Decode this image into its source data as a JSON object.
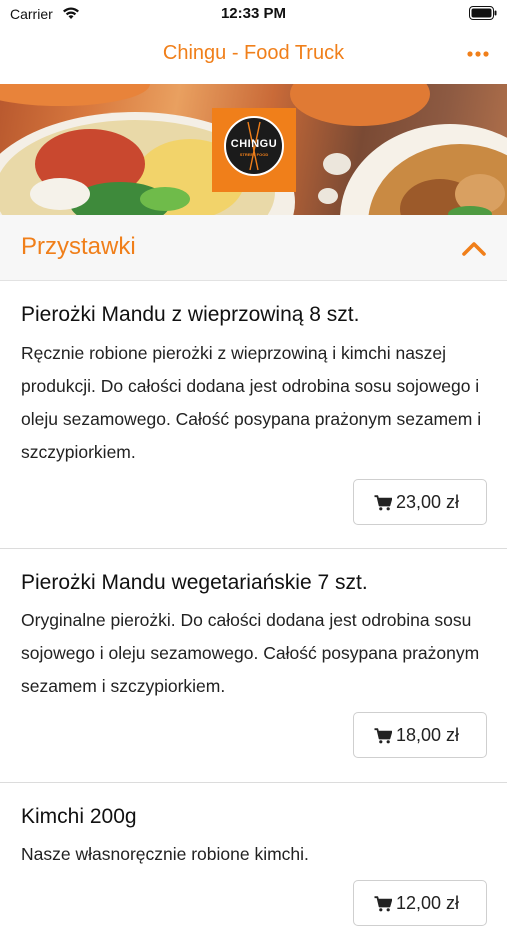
{
  "status_bar": {
    "carrier": "Carrier",
    "time": "12:33 PM"
  },
  "nav": {
    "title": "Chingu - Food Truck",
    "more_icon": "more-horizontal-icon"
  },
  "banner": {
    "logo_text": "CHINGU",
    "logo_subtext": "STREET FOOD"
  },
  "section": {
    "title": "Przystawki",
    "toggle_icon": "chevron-up-icon"
  },
  "items": [
    {
      "name": "Pierożki Mandu z wieprzowiną 8 szt.",
      "description": "Ręcznie robione pierożki z wieprzowiną i kimchi naszej produkcji. Do całości dodana jest odrobina sosu sojowego i oleju sezamowego. Całość posypana prażonym sezamem i szczypiorkiem.",
      "price": "23,00 zł"
    },
    {
      "name": "Pierożki Mandu wegetariańskie 7 szt.",
      "description": "Oryginalne pierożki. Do całości dodana jest odrobina sosu sojowego i oleju sezamowego. Całość posypana prażonym sezamem i szczypiorkiem.",
      "price": "18,00 zł"
    },
    {
      "name": "Kimchi 200g",
      "description": "Nasze własnoręcznie robione kimchi.",
      "price": "12,00 zł"
    }
  ],
  "colors": {
    "accent": "#f07f1a",
    "section_background": "#f7f7f7"
  }
}
